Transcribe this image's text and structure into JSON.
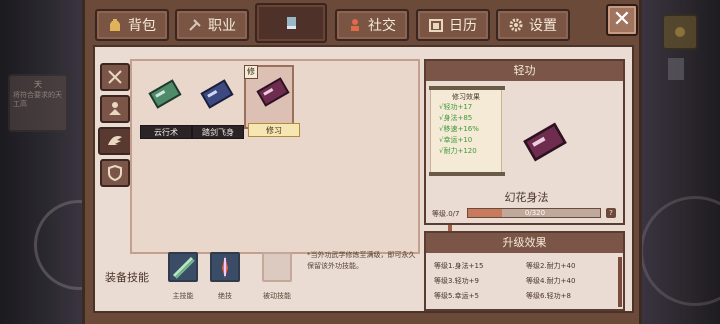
{
  "tabs": [
    {
      "label": "背包",
      "icon": "bag-icon"
    },
    {
      "label": "职业",
      "icon": "pick-icon"
    },
    {
      "label": "",
      "icon": "book-icon"
    },
    {
      "label": "社交",
      "icon": "person-icon"
    },
    {
      "label": "日历",
      "icon": "calendar-icon"
    },
    {
      "label": "设置",
      "icon": "gear-icon"
    }
  ],
  "colors": {
    "accent": "#7b5548",
    "frame": "#6b4a3a",
    "panel": "#eadcd3",
    "green_text": "#3f9a3a"
  },
  "background_panel": {
    "title": "天",
    "text": "将符合要求的天工高"
  },
  "skills": [
    {
      "name": "云行术",
      "color": "#4f8a6a"
    },
    {
      "name": "踏剑飞身",
      "color": "#3d4a82"
    },
    {
      "name": "修习",
      "color": "#6e2c4e",
      "tag": "修"
    }
  ],
  "equip": {
    "label": "装备技能",
    "slots": [
      {
        "label": "主技能"
      },
      {
        "label": "绝技"
      },
      {
        "label": "被动技能"
      }
    ],
    "note": "*当外功武学修炼至满级，即可永久保留该外功技能。"
  },
  "detail": {
    "title": "轻功",
    "effects_title": "修习效果",
    "effects": [
      "√轻功+17",
      "√身法+85",
      "√移速+16%",
      "√幸运+10",
      "√耐力+120"
    ],
    "skill_name": "幻花身法",
    "level_label": "等级.0/7",
    "progress_text": "0/320",
    "progress": 0.26,
    "level_button": "?"
  },
  "upgrade": {
    "title": "升级效果",
    "rows": [
      "等级1.身法+15",
      "等级2.耐力+40",
      "等级3.轻功+9",
      "等级4.耐力+40",
      "等级5.幸运+5",
      "等级6.轻功+8"
    ]
  },
  "close_label": "✕"
}
